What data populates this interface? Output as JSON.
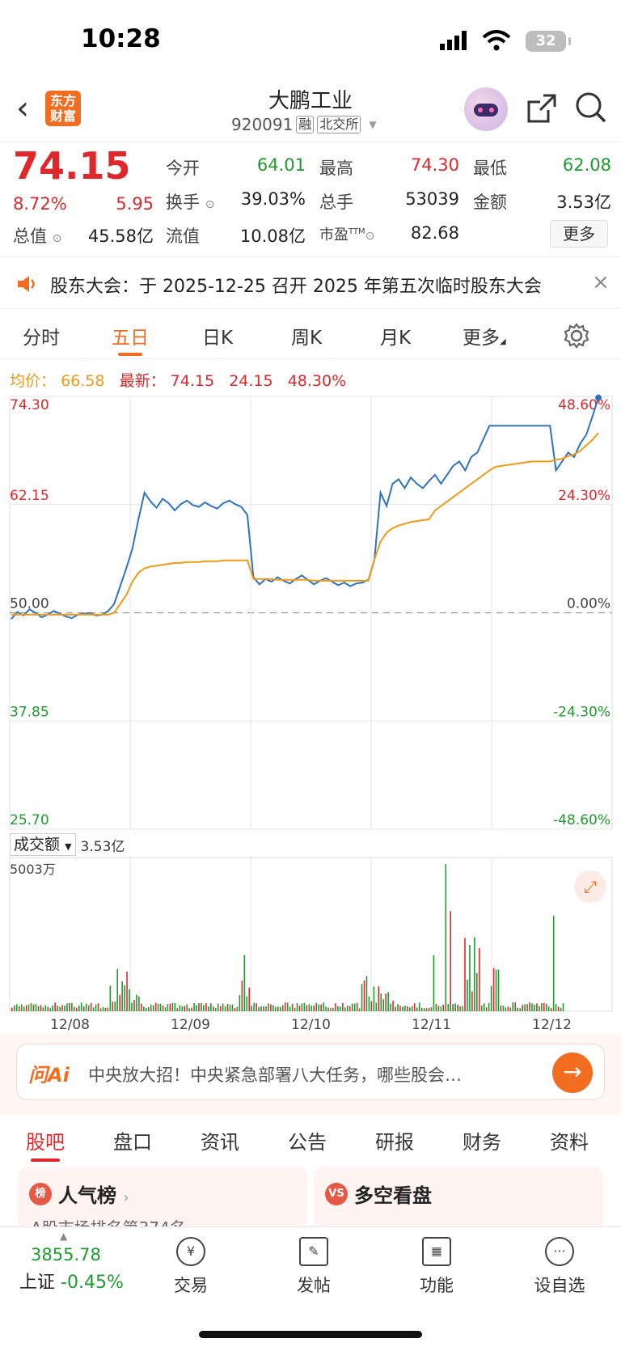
{
  "status": {
    "time": "10:28",
    "battery": "32"
  },
  "header": {
    "stock_name": "大鹏工业",
    "stock_code": "920091",
    "tag_margin": "融",
    "tag_exchange": "北交所",
    "logo_line1": "东方",
    "logo_line2": "财富"
  },
  "quote": {
    "price": "74.15",
    "change_pct": "8.72%",
    "change": "5.95",
    "open_label": "今开",
    "open": "64.01",
    "high_label": "最高",
    "high": "74.30",
    "low_label": "最低",
    "low": "62.08",
    "turnover_label": "换手",
    "turnover": "39.03%",
    "volume_label": "总手",
    "volume": "53039",
    "amount_label": "金额",
    "amount": "3.53亿",
    "mcap_label": "总值",
    "mcap": "45.58亿",
    "float_label": "流值",
    "float": "10.08亿",
    "pe_label": "市盈",
    "pe_sup": "TTM",
    "pe": "82.68",
    "more": "更多"
  },
  "notice": {
    "text": "股东大会：于 2025-12-25 召开 2025 年第五次临时股东大会",
    "close": "×"
  },
  "tabs": [
    "分时",
    "五日",
    "日K",
    "周K",
    "月K",
    "更多"
  ],
  "active_tab": "五日",
  "chart_info": {
    "avg_label": "均价：",
    "avg": "66.58",
    "latest_label": "最新：",
    "latest": "74.15",
    "chg": "24.15",
    "chg_pct": "48.30%"
  },
  "chart_data": {
    "type": "line",
    "y_left_ticks": [
      "74.30",
      "62.15",
      "50.00",
      "37.85",
      "25.70"
    ],
    "y_right_ticks": [
      "48.60%",
      "24.30%",
      "0.00%",
      "-24.30%",
      "-48.60%"
    ],
    "ylim": [
      25.7,
      74.3
    ],
    "baseline": 50.0,
    "x_labels": [
      "12/08",
      "12/09",
      "12/10",
      "12/11",
      "12/12"
    ],
    "series": [
      {
        "values": [
          49.3,
          50.1,
          49.7,
          50.4,
          50.0,
          49.5,
          49.8,
          50.2,
          49.9,
          49.6,
          49.4,
          49.8,
          49.9,
          50.0,
          49.7,
          49.8,
          50.2,
          51.0,
          53.0,
          55.0,
          57.2,
          60.5,
          63.5,
          62.5,
          61.8,
          62.8,
          62.3,
          61.5,
          62.2,
          62.6,
          62.1,
          61.9,
          62.4,
          62.0,
          61.7,
          62.3,
          62.6,
          62.2,
          61.9,
          61.0,
          54.0,
          53.2,
          53.8,
          53.5,
          54.0,
          53.6,
          53.3,
          53.8,
          54.2,
          53.7,
          53.2,
          53.6,
          53.9,
          53.5,
          53.1,
          53.4,
          53.0,
          53.3,
          53.4,
          53.7,
          56.0,
          63.5,
          62.0,
          64.5,
          65.0,
          64.0,
          65.2,
          64.5,
          64.0,
          64.8,
          65.5,
          64.5,
          65.5,
          66.5,
          67.0,
          66.0,
          67.5,
          68.0,
          69.5,
          71.0,
          71.0,
          71.0,
          71.0,
          71.0,
          71.0,
          71.0,
          71.0,
          71.0,
          71.0,
          71.0,
          66.0,
          67.0,
          68.0,
          67.5,
          69.0,
          70.0,
          72.0,
          74.15
        ]
      },
      {
        "values": [
          49.8,
          49.8,
          49.8,
          49.8,
          49.8,
          49.8,
          49.8,
          49.8,
          49.8,
          49.8,
          49.8,
          49.8,
          49.8,
          49.8,
          49.8,
          49.8,
          49.8,
          50.0,
          51.0,
          52.0,
          53.5,
          54.5,
          55.0,
          55.2,
          55.3,
          55.4,
          55.5,
          55.6,
          55.6,
          55.7,
          55.7,
          55.7,
          55.8,
          55.8,
          55.8,
          55.9,
          55.9,
          55.9,
          55.9,
          55.9,
          53.8,
          53.8,
          53.8,
          53.8,
          53.7,
          53.7,
          53.7,
          53.7,
          53.7,
          53.7,
          53.6,
          53.6,
          53.6,
          53.6,
          53.6,
          53.6,
          53.6,
          53.6,
          53.6,
          53.6,
          56.0,
          58.0,
          59.0,
          59.5,
          59.8,
          60.0,
          60.2,
          60.3,
          60.4,
          60.5,
          61.5,
          62.0,
          62.5,
          63.0,
          63.5,
          64.0,
          64.5,
          65.0,
          65.5,
          66.0,
          66.4,
          66.5,
          66.6,
          66.7,
          66.8,
          66.9,
          67.0,
          67.0,
          67.0,
          67.0,
          67.2,
          67.3,
          67.6,
          67.8,
          68.2,
          68.8,
          69.4,
          70.2
        ]
      }
    ],
    "volume_label": "5003万"
  },
  "volume_select": "成交额",
  "volume_total": "3.53亿",
  "ai": {
    "logo": "问Ai",
    "text": "中央放大招！中央紧急部署八大任务，哪些股会…"
  },
  "bottom_tabs": [
    "股吧",
    "盘口",
    "资讯",
    "公告",
    "研报",
    "财务",
    "资料"
  ],
  "active_bottom_tab": "股吧",
  "cards": [
    {
      "title": "人气榜",
      "sub": "A股市场排名第374名",
      "icon": "榜"
    },
    {
      "title": "多空看盘",
      "icon": "VS"
    }
  ],
  "bottom_nav": {
    "index_value": "3855.78",
    "index_name": "上证",
    "index_change": "-0.45%",
    "items": [
      "交易",
      "发帖",
      "功能",
      "设自选"
    ]
  },
  "colors": {
    "accent": "#f36d21",
    "up": "#e0272c",
    "down": "#1e9b2e",
    "price_line": "#2f74c0",
    "avg_line": "#f09a18"
  }
}
